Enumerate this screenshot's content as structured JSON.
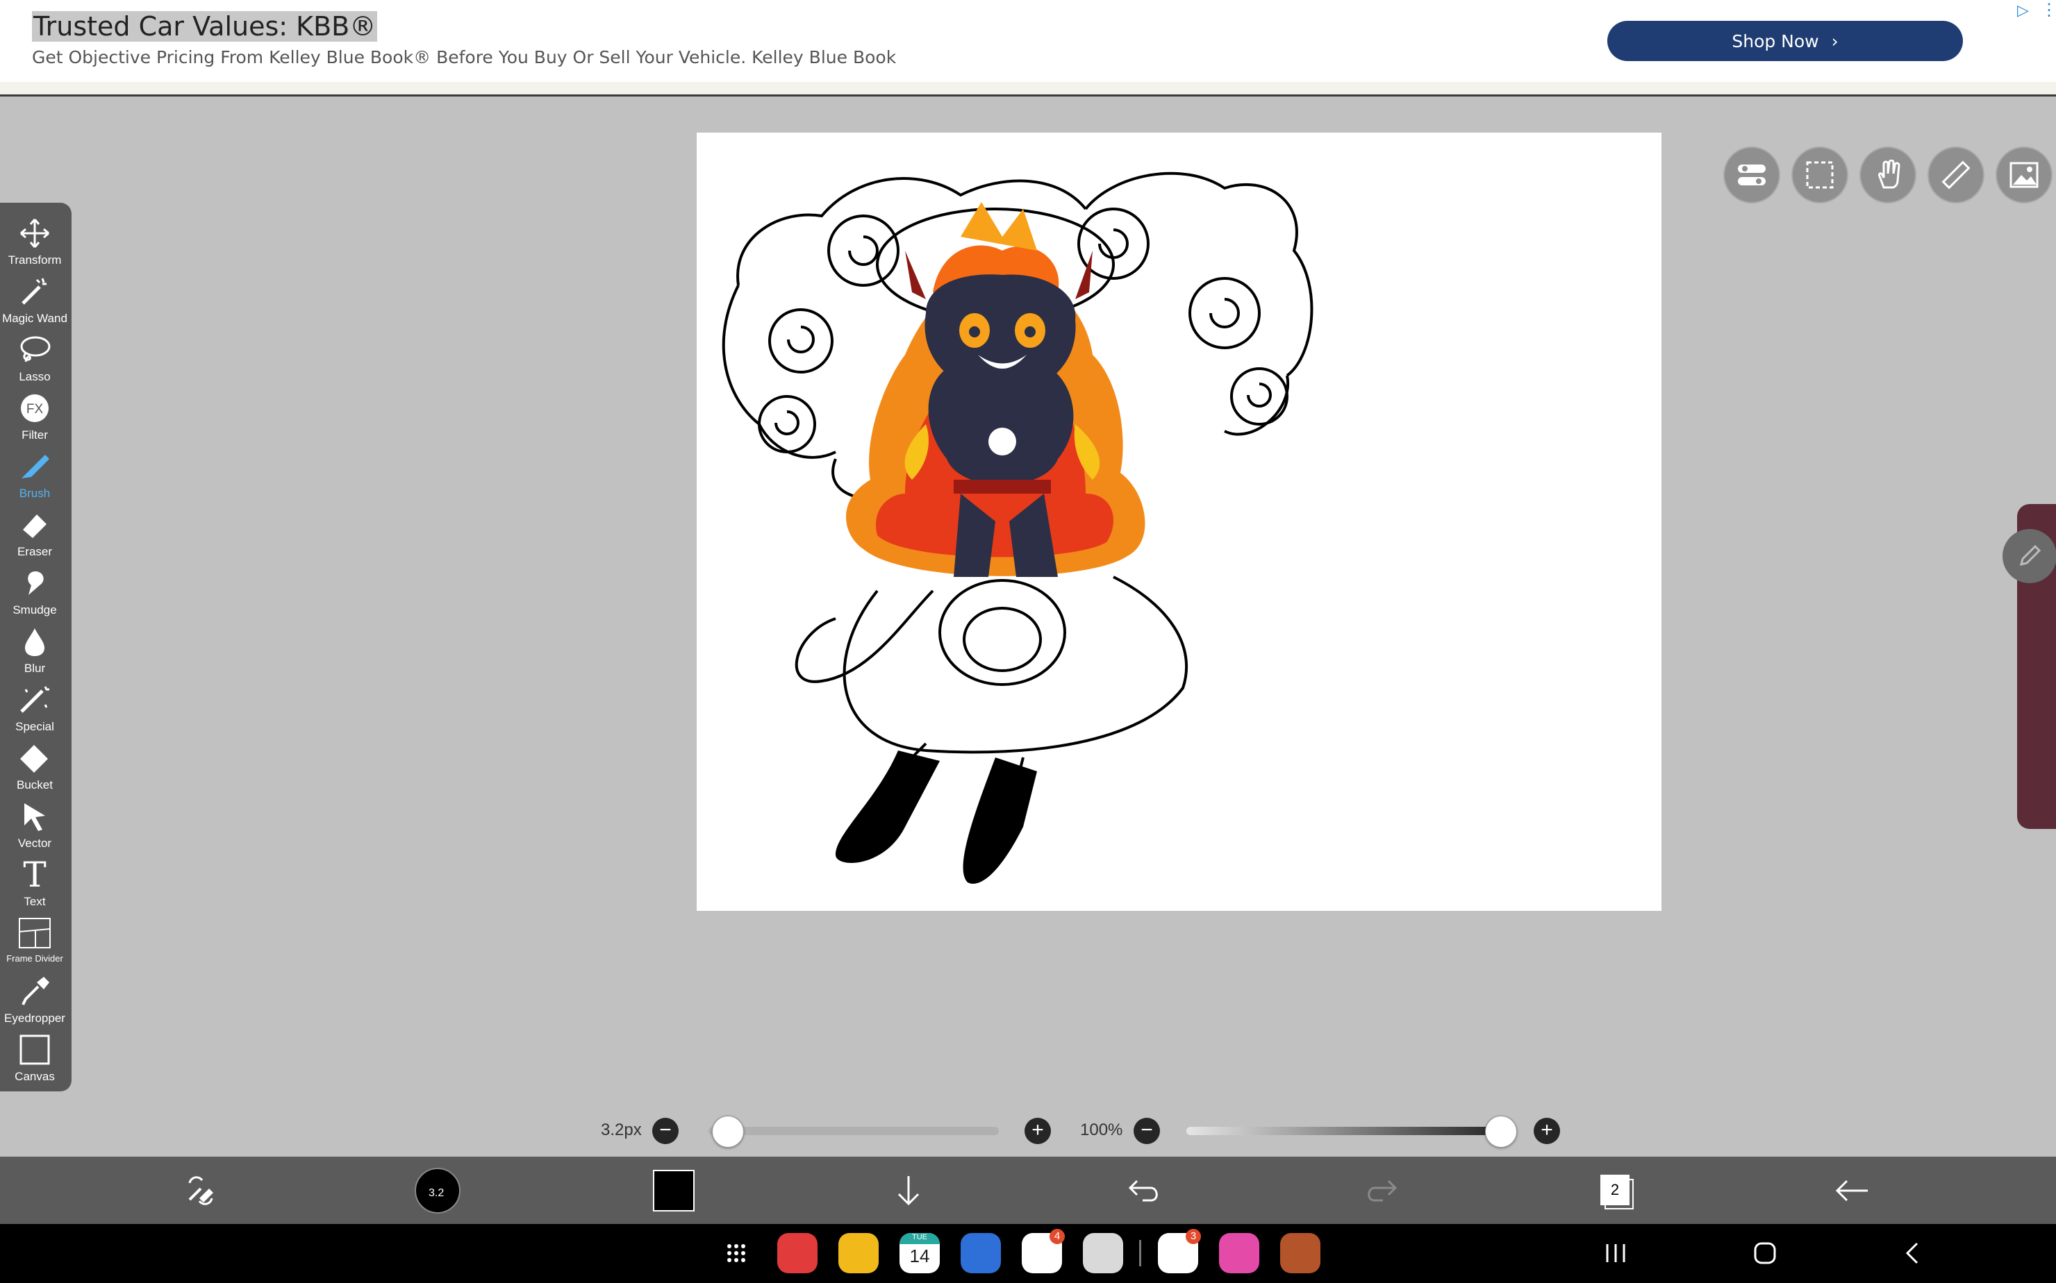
{
  "ad": {
    "title": "Trusted Car Values: KBB®",
    "subtitle": "Get Objective Pricing From Kelley Blue Book® Before You Buy Or Sell Your Vehicle. Kelley Blue Book",
    "button_label": "Shop Now",
    "adchoices_icon": "adchoices-icon",
    "more_icon": "more-vertical-icon"
  },
  "tools": [
    {
      "label": "Transform",
      "icon": "move-arrows-icon"
    },
    {
      "label": "Magic Wand",
      "icon": "magic-wand-icon"
    },
    {
      "label": "Lasso",
      "icon": "lasso-icon"
    },
    {
      "label": "Filter",
      "icon": "fx-icon"
    },
    {
      "label": "Brush",
      "icon": "brush-icon",
      "active": true
    },
    {
      "label": "Eraser",
      "icon": "eraser-icon"
    },
    {
      "label": "Smudge",
      "icon": "smudge-icon"
    },
    {
      "label": "Blur",
      "icon": "drop-icon"
    },
    {
      "label": "Special",
      "icon": "special-brush-icon"
    },
    {
      "label": "Bucket",
      "icon": "bucket-icon"
    },
    {
      "label": "Vector",
      "icon": "cursor-arrow-icon"
    },
    {
      "label": "Text",
      "icon": "text-T-icon"
    },
    {
      "label": "Frame Divider",
      "icon": "frame-divider-icon"
    },
    {
      "label": "Eyedropper",
      "icon": "eyedropper-icon"
    },
    {
      "label": "Canvas",
      "icon": "canvas-square-icon"
    }
  ],
  "top_controls": [
    "toggle-icon",
    "selection-icon",
    "hand-icon",
    "ruler-icon",
    "image-icon"
  ],
  "brush_size": {
    "label": "3.2px",
    "value_fraction": 0.03
  },
  "opacity": {
    "label": "100%",
    "value_fraction": 1.0
  },
  "bottom": {
    "brush_badge": "3.2",
    "color_hex": "#000000",
    "layers_count": "2"
  },
  "dock_apps": [
    {
      "name": "app-drawer",
      "color": "#000000"
    },
    {
      "name": "notes-app",
      "color": "#e23b3b"
    },
    {
      "name": "files-app",
      "color": "#f2b91a"
    },
    {
      "name": "calendar-app",
      "color": "#ffffff",
      "day": "TUE",
      "date": "14"
    },
    {
      "name": "messages-app",
      "color": "#2e6fd8"
    },
    {
      "name": "chrome-app",
      "color": "#ffffff",
      "badge": "4"
    },
    {
      "name": "camera-app",
      "color": "#d9d9d9"
    },
    {
      "name": "google-app",
      "color": "#ffffff",
      "badge": "3"
    },
    {
      "name": "flower-app",
      "color": "#e44aa8"
    },
    {
      "name": "game-app",
      "color": "#b4542a"
    }
  ],
  "colors": {
    "accent_blue": "#54b3f2",
    "ad_button": "#1f3d72",
    "toolbar": "#585858"
  }
}
